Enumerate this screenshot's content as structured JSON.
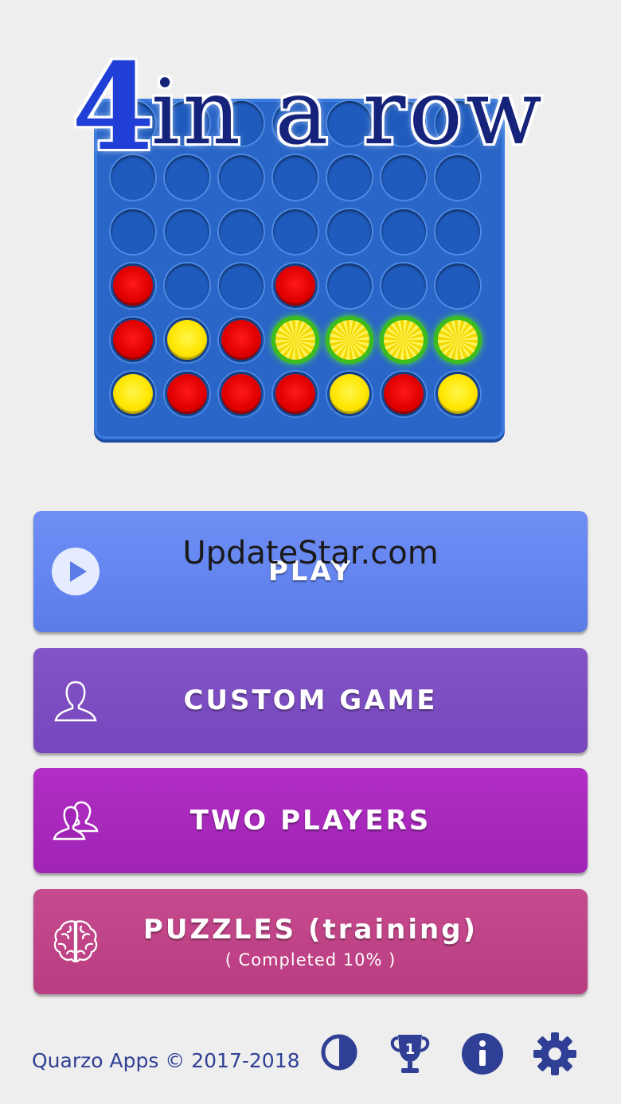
{
  "logo": {
    "digit": "4",
    "words": "in a row"
  },
  "board": {
    "rows": [
      [
        "empty",
        "empty",
        "empty",
        "empty",
        "empty",
        "empty",
        "empty"
      ],
      [
        "empty",
        "empty",
        "empty",
        "empty",
        "empty",
        "empty",
        "empty"
      ],
      [
        "empty",
        "empty",
        "empty",
        "empty",
        "empty",
        "empty",
        "empty"
      ],
      [
        "red",
        "empty",
        "empty",
        "red",
        "empty",
        "empty",
        "empty"
      ],
      [
        "red",
        "yellow",
        "red",
        "win",
        "win",
        "win",
        "win"
      ],
      [
        "yellow",
        "red",
        "red",
        "red",
        "yellow",
        "red",
        "yellow"
      ]
    ],
    "colors": {
      "red": "#e00000",
      "yellow": "#ffe600",
      "win_glow": "#3bbd1c",
      "board": "#2a66c8"
    }
  },
  "watermark": "UpdateStar.com",
  "menu": {
    "play": {
      "label": "PLAY",
      "icon": "play-circle-icon"
    },
    "custom": {
      "label": "CUSTOM GAME",
      "icon": "user-silhouette-icon"
    },
    "two": {
      "label": "TWO PLAYERS",
      "icon": "two-users-icon"
    },
    "puzzles": {
      "label": "PUZZLES (training)",
      "sub": "( Completed  10% )",
      "icon": "brain-icon"
    }
  },
  "footer": {
    "brand": "Quarzo Apps  © 2017-2018",
    "icons": [
      "contrast-icon",
      "trophy-icon",
      "info-icon",
      "gear-icon"
    ],
    "trophy_number": "1"
  }
}
